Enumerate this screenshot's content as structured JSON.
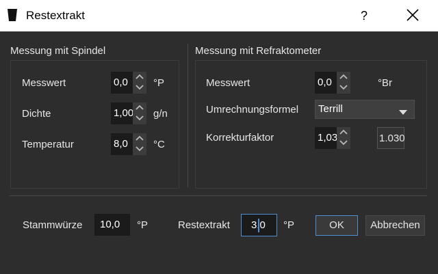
{
  "window": {
    "title": "Restextrakt",
    "help": "?"
  },
  "spindel": {
    "title": "Messung mit Spindel",
    "messwert": {
      "label": "Messwert",
      "value": "0,0",
      "unit": "°P"
    },
    "dichte": {
      "label": "Dichte",
      "value": "1,00",
      "unit": "g/n"
    },
    "temperatur": {
      "label": "Temperatur",
      "value": "8,0",
      "unit": "°C"
    }
  },
  "refrakto": {
    "title": "Messung mit Refraktometer",
    "messwert": {
      "label": "Messwert",
      "value": "0,0",
      "unit": "°Br"
    },
    "formel": {
      "label": "Umrechnungsformel",
      "value": "Terrill"
    },
    "korrektur": {
      "label": "Korrekturfaktor",
      "value": "1,03",
      "calc": "1.030"
    }
  },
  "bottom": {
    "stammwuerze": {
      "label": "Stammwürze",
      "value": "10,0",
      "unit": "°P"
    },
    "restextrakt": {
      "label": "Restextrakt",
      "value": "3,0",
      "unit": "°P"
    },
    "ok": "OK",
    "cancel": "Abbrechen"
  }
}
